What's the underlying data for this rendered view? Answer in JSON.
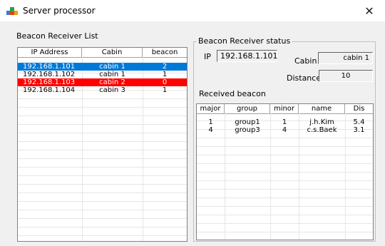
{
  "window": {
    "title": "Server processor",
    "close": "✕"
  },
  "left": {
    "title": "Beacon Receiver List",
    "columns": [
      "IP Address",
      "Cabin",
      "beacon"
    ],
    "rows": [
      {
        "ip": "192.168.1.101",
        "cabin": "cabin 1",
        "beacon": "2",
        "state": "selected-blue"
      },
      {
        "ip": "192.168.1.102",
        "cabin": "cabin 1",
        "beacon": "1",
        "state": "normal"
      },
      {
        "ip": "192.168.1.103",
        "cabin": "cabin 2",
        "beacon": "0",
        "state": "highlight-red"
      },
      {
        "ip": "192.168.1.104",
        "cabin": "cabin 3",
        "beacon": "1",
        "state": "normal"
      }
    ]
  },
  "status": {
    "title": "Beacon Receiver status",
    "ip_label": "IP",
    "ip_value": "192.168.1.101",
    "cabin_label": "Cabin",
    "cabin_value": "cabin 1",
    "distance_label": "Distance",
    "distance_value": "10",
    "received_title": "Received beacon",
    "columns": [
      "major",
      "group",
      "minor",
      "name",
      "Dis"
    ],
    "rows": [
      {
        "major": "1",
        "group": "group1",
        "minor": "1",
        "name": "j.h.Kim",
        "dis": "5.4"
      },
      {
        "major": "4",
        "group": "group3",
        "minor": "4",
        "name": "c.s.Baek",
        "dis": "3.1"
      }
    ]
  },
  "colors": {
    "selected": "#0078d7",
    "error": "#ff0000",
    "frame": "#828282"
  }
}
